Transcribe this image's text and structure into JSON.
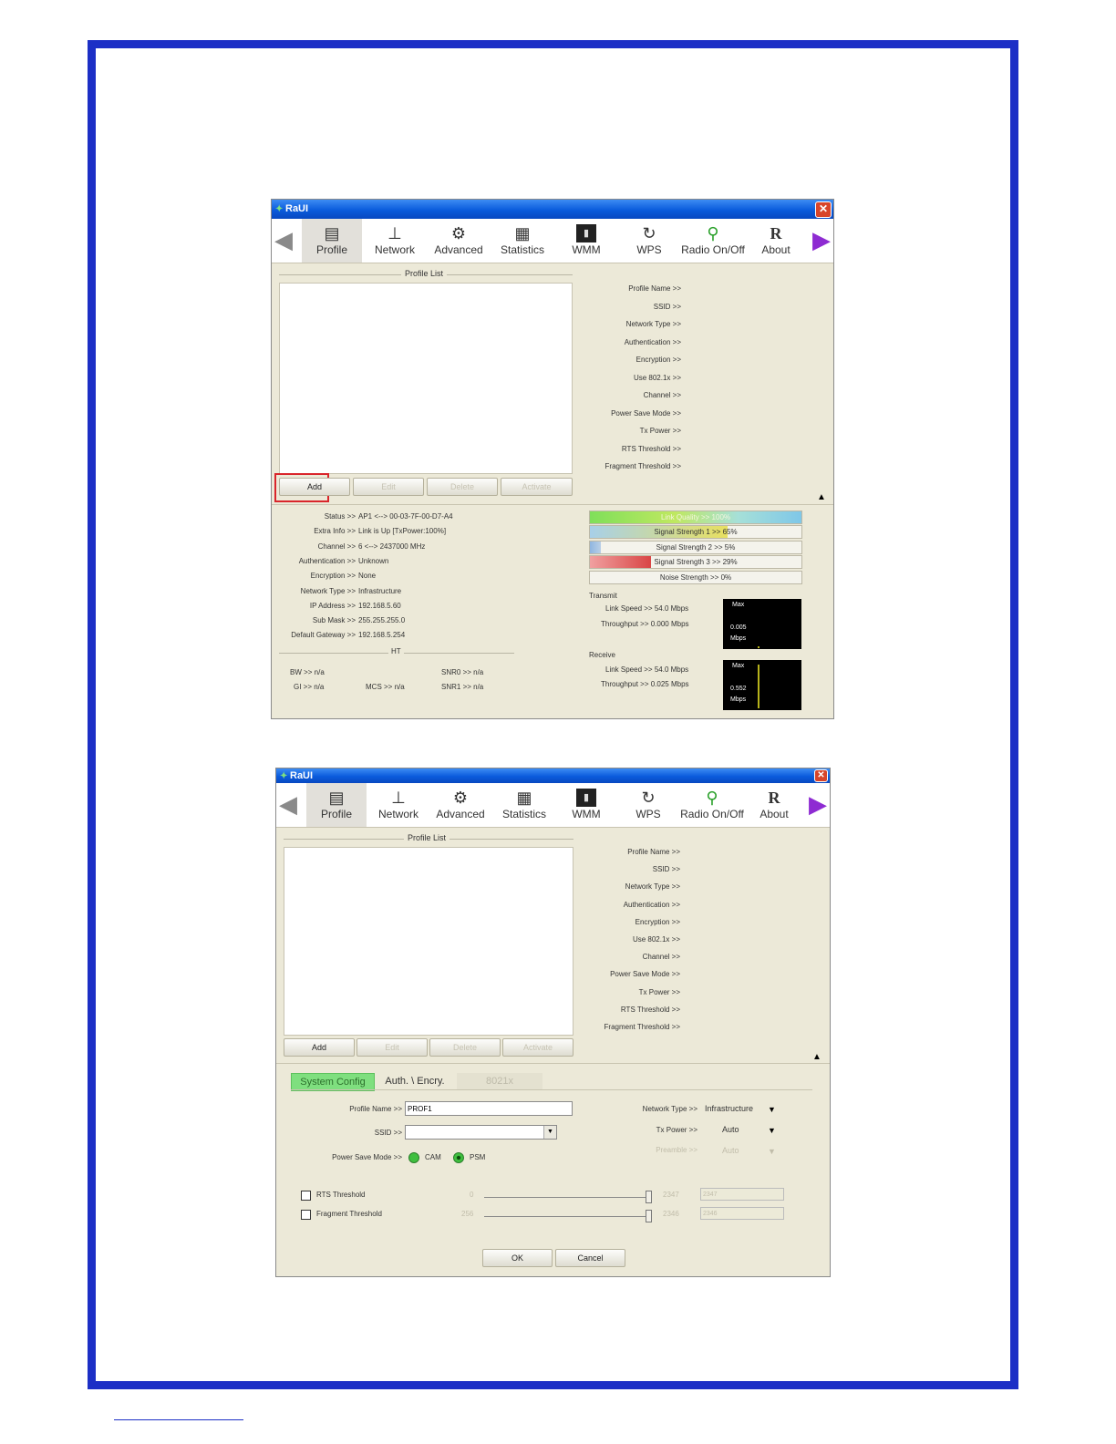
{
  "app_title": "RaUI",
  "toolbar": {
    "items": [
      {
        "label": "Profile",
        "icon": "profile-icon"
      },
      {
        "label": "Network",
        "icon": "network-icon"
      },
      {
        "label": "Advanced",
        "icon": "advanced-icon"
      },
      {
        "label": "Statistics",
        "icon": "statistics-icon"
      },
      {
        "label": "WMM",
        "icon": "wmm-icon"
      },
      {
        "label": "WPS",
        "icon": "wps-icon"
      },
      {
        "label": "Radio On/Off",
        "icon": "radio-icon"
      },
      {
        "label": "About",
        "icon": "about-icon"
      }
    ]
  },
  "profile_list": {
    "title": "Profile List",
    "buttons": {
      "add": "Add",
      "edit": "Edit",
      "delete": "Delete",
      "activate": "Activate"
    }
  },
  "profile_fields": [
    "Profile Name >>",
    "SSID >>",
    "Network Type >>",
    "Authentication >>",
    "Encryption >>",
    "Use 802.1x >>",
    "Channel >>",
    "Power Save Mode >>",
    "Tx Power >>",
    "RTS Threshold >>",
    "Fragment Threshold >>"
  ],
  "status": {
    "rows": [
      {
        "label": "Status >>",
        "value": "AP1 <--> 00-03-7F-00-D7-A4"
      },
      {
        "label": "Extra Info >>",
        "value": "Link is Up [TxPower:100%]"
      },
      {
        "label": "Channel >>",
        "value": "6 <--> 2437000 MHz"
      },
      {
        "label": "Authentication >>",
        "value": "Unknown"
      },
      {
        "label": "Encryption >>",
        "value": "None"
      },
      {
        "label": "Network Type >>",
        "value": "Infrastructure"
      },
      {
        "label": "IP Address >>",
        "value": "192.168.5.60"
      },
      {
        "label": "Sub Mask >>",
        "value": "255.255.255.0"
      },
      {
        "label": "Default Gateway >>",
        "value": "192.168.5.254"
      }
    ],
    "ht_title": "HT",
    "ht": {
      "bw": "BW >> n/a",
      "gi": "GI >> n/a",
      "mcs": "MCS >> n/a",
      "snr0": "SNR0 >> n/a",
      "snr1": "SNR1 >> n/a"
    }
  },
  "meters": [
    {
      "text": "Link Quality >> 100%",
      "fill": 1.0
    },
    {
      "text": "Signal Strength 1 >> 65%",
      "fill": 0.65
    },
    {
      "text": "Signal Strength 2 >> 5%",
      "fill": 0.05
    },
    {
      "text": "Signal Strength 3 >> 29%",
      "fill": 0.29
    },
    {
      "text": "Noise Strength >> 0%",
      "fill": 0.0
    }
  ],
  "transmit": {
    "title": "Transmit",
    "link_speed": "Link Speed >> 54.0 Mbps",
    "throughput": "Throughput >> 0.000 Mbps",
    "graph_max": "Max",
    "graph_value": "0.005",
    "graph_unit": "Mbps"
  },
  "receive": {
    "title": "Receive",
    "link_speed": "Link Speed >> 54.0 Mbps",
    "throughput": "Throughput >> 0.025 Mbps",
    "graph_max": "Max",
    "graph_value": "0.552",
    "graph_unit": "Mbps"
  },
  "config": {
    "tabs": [
      "System Config",
      "Auth. \\ Encry.",
      "8021x"
    ],
    "profile_name_label": "Profile Name >>",
    "profile_name_value": "PROF1",
    "ssid_label": "SSID >>",
    "ssid_value": "",
    "psm_label": "Power Save Mode >>",
    "psm_cam": "CAM",
    "psm_psm": "PSM",
    "network_type_label": "Network Type >>",
    "network_type_value": "Infrastructure",
    "tx_power_label": "Tx Power >>",
    "tx_power_value": "Auto",
    "preamble_label": "Preamble >>",
    "preamble_value": "Auto",
    "rts_label": "RTS Threshold",
    "rts_min": "0",
    "rts_max": "2347",
    "rts_value": "2347",
    "frag_label": "Fragment Threshold",
    "frag_min": "256",
    "frag_max": "2346",
    "frag_value": "2346",
    "ok": "OK",
    "cancel": "Cancel"
  },
  "colors": {
    "page_border": "#1c2fc6",
    "window_bg": "#ece9d8",
    "titlebar": "#0a5bdc",
    "highlight": "#d9252b",
    "active_tab": "#7fdf7f"
  }
}
